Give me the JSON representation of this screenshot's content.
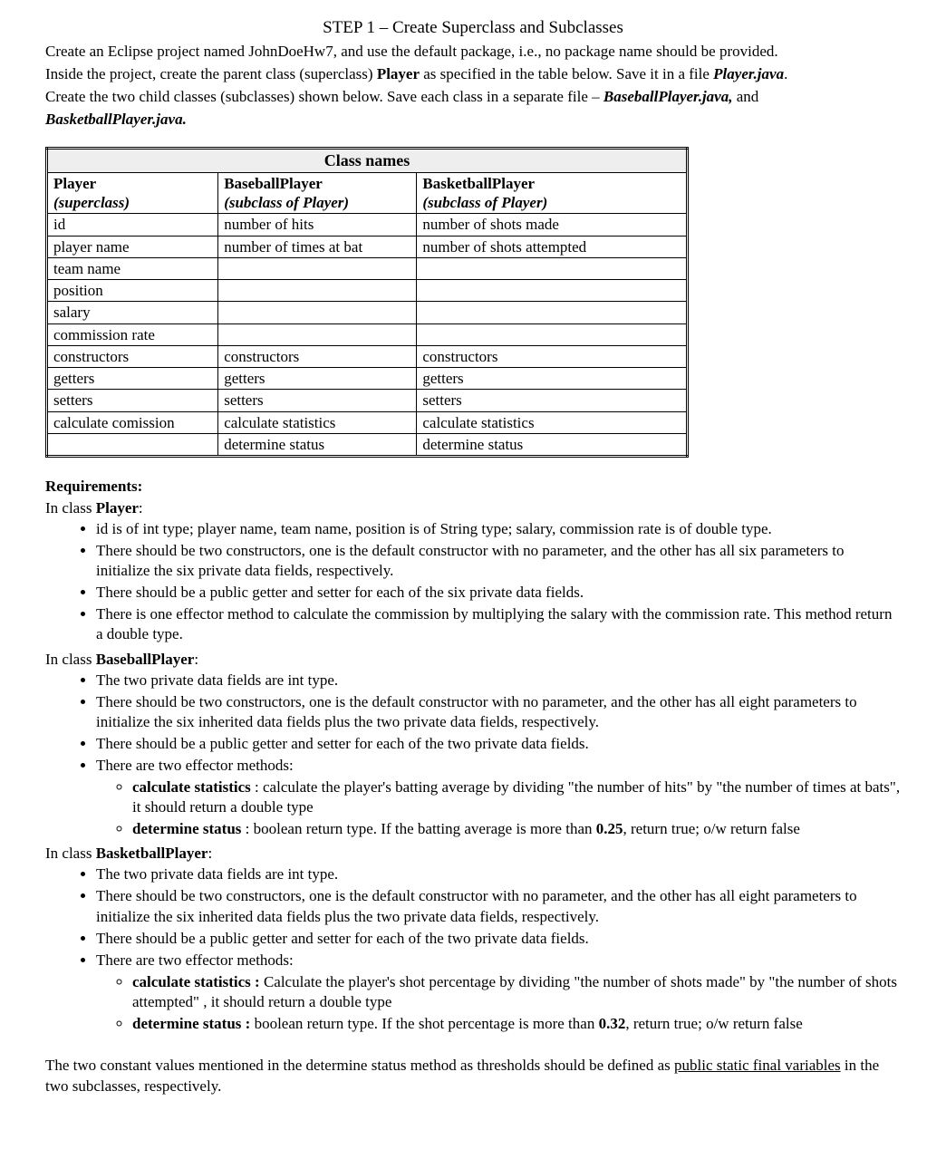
{
  "step_title": "STEP 1 – Create Superclass and Subclasses",
  "intro": {
    "l1a": "Create an Eclipse project named JohnDoeHw7, and use the default package, i.e., no package name should be provided.",
    "l2a": "Inside the project, create the parent class (superclass) ",
    "l2b": "Player",
    "l2c": " as specified in the table below. Save it in a file ",
    "l2d": "Player.java",
    "l2e": ".",
    "l3a": "Create the two child classes (subclasses) shown below. Save each class in a separate file – ",
    "l3b": "BaseballPlayer.java,",
    "l3c": " and",
    "l4a": "BasketballPlayer.java."
  },
  "table": {
    "header": "Class names",
    "cols": [
      {
        "name": "Player",
        "note": "(superclass)"
      },
      {
        "name": "BaseballPlayer",
        "note": "(subclass of Player)"
      },
      {
        "name": "BasketballPlayer",
        "note": "(subclass of Player)"
      }
    ],
    "rows": [
      [
        "id",
        "number of hits",
        "number of shots made"
      ],
      [
        "player name",
        "number of times at bat",
        "number of shots attempted"
      ],
      [
        "team name",
        "",
        ""
      ],
      [
        "position",
        "",
        ""
      ],
      [
        "salary",
        "",
        ""
      ],
      [
        "commission rate",
        "",
        ""
      ],
      [
        "constructors",
        "constructors",
        "constructors"
      ],
      [
        "getters",
        "getters",
        "getters"
      ],
      [
        "setters",
        "setters",
        "setters"
      ],
      [
        "calculate comission",
        "calculate statistics",
        "calculate statistics"
      ],
      [
        "",
        "determine status",
        "determine status"
      ]
    ]
  },
  "req_head": "Requirements:",
  "player": {
    "head_a": "In class ",
    "head_b": "Player",
    "head_c": ":",
    "b1": "id is of int type;  player name, team name, position is of String type; salary, commission rate is of double type.",
    "b2": "There should be two constructors, one is the default constructor with no parameter, and the other has all six parameters to initialize the six private data fields, respectively.",
    "b3": "There should be a public getter and setter for each of the six private data fields.",
    "b4": "There is one effector method to calculate the commission by multiplying the salary with the commission rate. This method return a double type."
  },
  "baseball": {
    "head_a": "In class ",
    "head_b": "BaseballPlayer",
    "head_c": ":",
    "b1": "The two private data fields are int type.",
    "b2": "There should be two constructors, one is the default constructor with no parameter, and the other has all eight parameters to initialize the six inherited data fields plus the two private data fields, respectively.",
    "b3": "There should be a public getter and setter for each of the two private data fields.",
    "b4": "There are two effector methods:",
    "s1a": "calculate statistics",
    "s1b": " : calculate the player's batting average by dividing \"the number of hits\" by \"the number of times at bats\", it should return a double type",
    "s2a": "determine status",
    "s2b": " : boolean return type. If the batting average is more than ",
    "s2c": "0.25",
    "s2d": ", return true; o/w return false"
  },
  "basketball": {
    "head_a": "In class ",
    "head_b": "BasketballPlayer",
    "head_c": ":",
    "b1": "The two private data fields are int type.",
    "b2": "There should be two constructors, one is the default constructor with no parameter, and the other has all eight parameters to initialize the six inherited data fields plus the two private data fields, respectively.",
    "b3": "There should be a public getter and setter for each of the two private data fields.",
    "b4": "There are two effector methods:",
    "s1a": "calculate statistics :",
    "s1b": " Calculate the player's shot percentage by dividing \"the number of shots made\" by \"the number of shots attempted\" , it should return a double type",
    "s2a": "determine status :",
    "s2b": " boolean return type. If the shot percentage is more than ",
    "s2c": "0.32",
    "s2d": ", return true; o/w return false"
  },
  "footer": {
    "a": "The two constant values mentioned in the determine status method as thresholds should be defined as ",
    "b": "public static final variables",
    "c": " in the two subclasses, respectively."
  }
}
